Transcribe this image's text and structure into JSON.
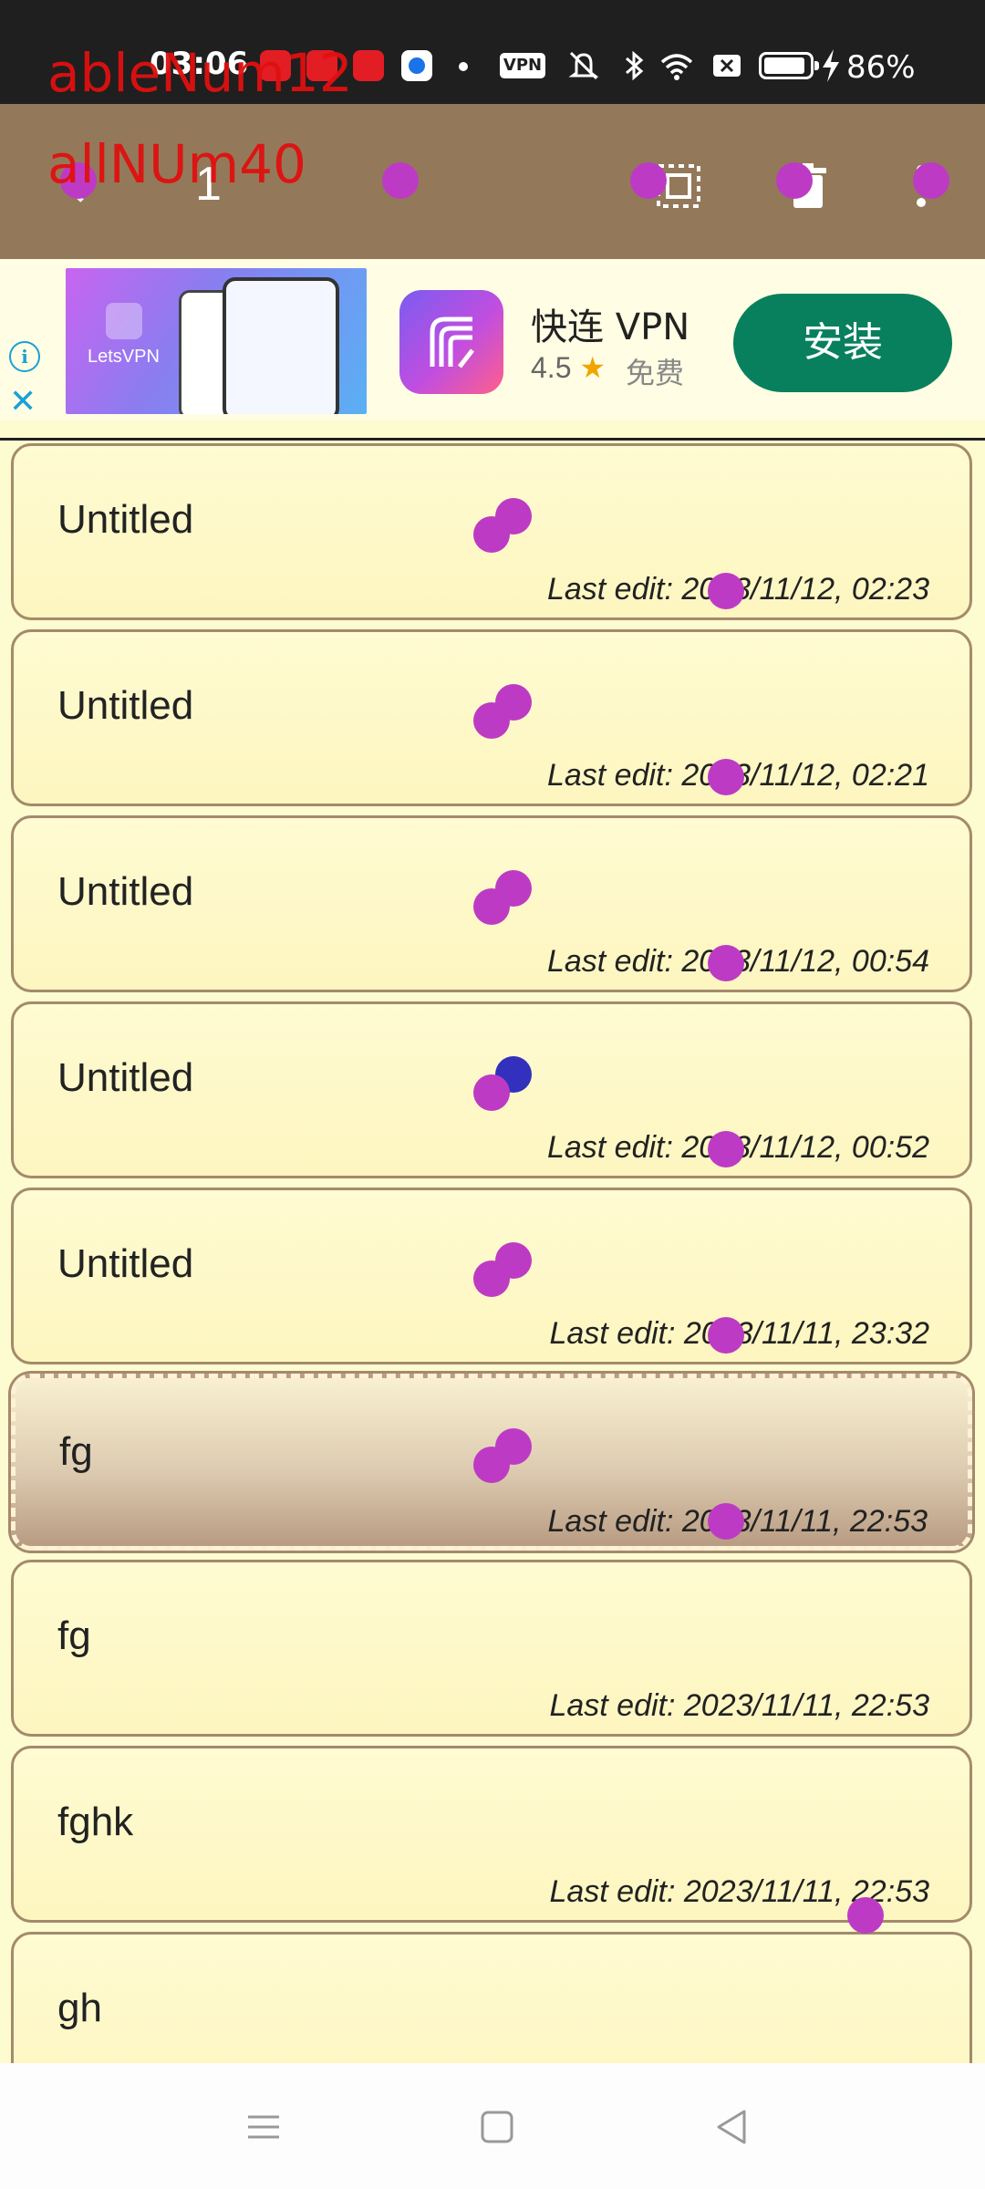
{
  "status_bar": {
    "time": "03:06",
    "battery_percent": "86%",
    "vpn_label": "VPN",
    "icons": [
      "app-notification-icon",
      "app-notification-icon",
      "app-notification-icon",
      "app-notification-icon",
      "dot-icon",
      "vpn-icon",
      "mute-icon",
      "bluetooth-icon",
      "wifi-icon",
      "sim-off-icon",
      "battery-icon",
      "charging-icon"
    ]
  },
  "debug_overlay": {
    "line1": "ableNum12",
    "line2": "allNUm40"
  },
  "toolbar": {
    "selected_count": "1",
    "icons": [
      "back-icon",
      "select-all-icon",
      "delete-icon",
      "more-icon"
    ],
    "background": "#93795a"
  },
  "ad": {
    "title": "快连 VPN",
    "rating": "4.5",
    "price": "免费",
    "install_label": "安装",
    "image_brand": "LetsVPN",
    "install_color": "#09805d"
  },
  "notes": [
    {
      "title": "Untitled",
      "date": "Last edit: 2023/11/12, 02:23",
      "selected": false
    },
    {
      "title": "Untitled",
      "date": "Last edit: 2023/11/12, 02:21",
      "selected": false
    },
    {
      "title": "Untitled",
      "date": "Last edit: 2023/11/12, 00:54",
      "selected": false
    },
    {
      "title": "Untitled",
      "date": "Last edit: 2023/11/12, 00:52",
      "selected": false
    },
    {
      "title": "Untitled",
      "date": "Last edit: 2023/11/11, 23:32",
      "selected": false
    },
    {
      "title": "fg",
      "date": "Last edit: 2023/11/11, 22:53",
      "selected": true
    },
    {
      "title": "fg",
      "date": "Last edit: 2023/11/11, 22:53",
      "selected": false
    },
    {
      "title": "fghk",
      "date": "Last edit: 2023/11/11, 22:53",
      "selected": false
    },
    {
      "title": "gh",
      "date": "",
      "selected": false
    }
  ],
  "navbar": {
    "icons": [
      "menu-icon",
      "home-icon",
      "back-icon"
    ]
  }
}
